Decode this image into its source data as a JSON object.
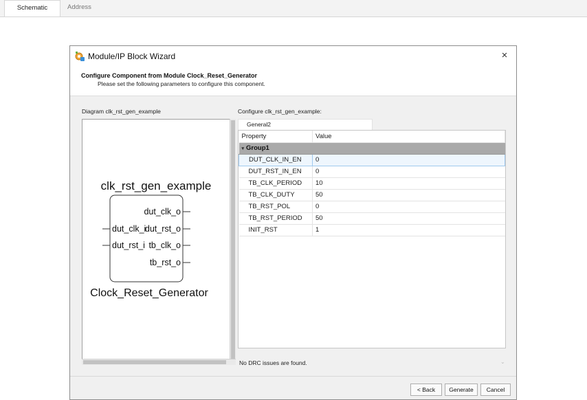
{
  "top_tabs": {
    "schematic": "Schematic",
    "address": "Address"
  },
  "dialog": {
    "title": "Module/IP Block Wizard",
    "close_glyph": "×",
    "header_title": "Configure Component from Module Clock_Reset_Generator",
    "header_subtitle": "Please set the following parameters to configure this component.",
    "diagram_label": "Diagram clk_rst_gen_example",
    "configure_label": "Configure clk_rst_gen_example:",
    "config_tab": "General2",
    "drc_status": "No DRC issues are found.",
    "buttons": {
      "back": "< Back",
      "generate": "Generate",
      "cancel": "Cancel"
    }
  },
  "diagram": {
    "instance_name": "clk_rst_gen_example",
    "module_name": "Clock_Reset_Generator",
    "input_ports": [
      "dut_clk_i",
      "dut_rst_i"
    ],
    "output_ports": [
      "dut_clk_o",
      "dut_rst_o",
      "tb_clk_o",
      "tb_rst_o"
    ]
  },
  "property_table": {
    "headers": {
      "property": "Property",
      "value": "Value"
    },
    "group": "Group1",
    "rows": [
      {
        "name": "DUT_CLK_IN_EN",
        "value": "0"
      },
      {
        "name": "DUT_RST_IN_EN",
        "value": "0"
      },
      {
        "name": "TB_CLK_PERIOD",
        "value": "10"
      },
      {
        "name": "TB_CLK_DUTY",
        "value": "50"
      },
      {
        "name": "TB_RST_POL",
        "value": "0"
      },
      {
        "name": "TB_RST_PERIOD",
        "value": "50"
      },
      {
        "name": "INIT_RST",
        "value": "1"
      }
    ]
  },
  "icons": {
    "app": "gear-wizard-icon",
    "close": "close-icon",
    "group_caret": "caret-down-icon",
    "drc_expand": "chevron-down-icon"
  },
  "colors": {
    "group_header": "#a9a9a9",
    "selected_row": "#eef6fd",
    "selected_border": "#9fc9ee",
    "dialog_bg": "#f0f0f0"
  }
}
